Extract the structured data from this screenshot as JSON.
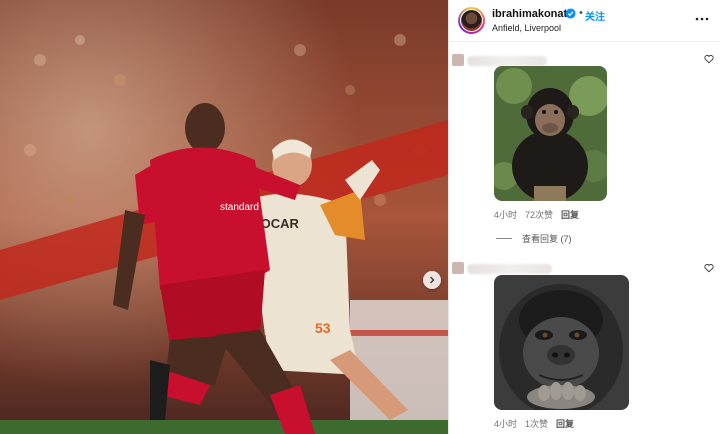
{
  "post": {
    "username": "ibrahimakonate",
    "follow_label": "关注",
    "separator": "•",
    "location": "Anfield, Liverpool",
    "shirt_sponsor": "SOCAR",
    "shirt_number": "53"
  },
  "comments": [
    {
      "image_label": "chimpanzee",
      "time": "4小时",
      "likes": "72次赞",
      "reply_label": "回复"
    },
    {
      "image_label": "gorilla",
      "time": "4小时",
      "likes": "1次赞",
      "reply_label": "回复"
    }
  ],
  "view_replies": "查看回复 (7)",
  "colors": {
    "accent": "#0095f6",
    "liverpool_red": "#c8102e",
    "verified": "#0095f6"
  },
  "icons": [
    "chevron-right-icon",
    "verified-badge-icon",
    "more-options-icon",
    "heart-icon"
  ]
}
